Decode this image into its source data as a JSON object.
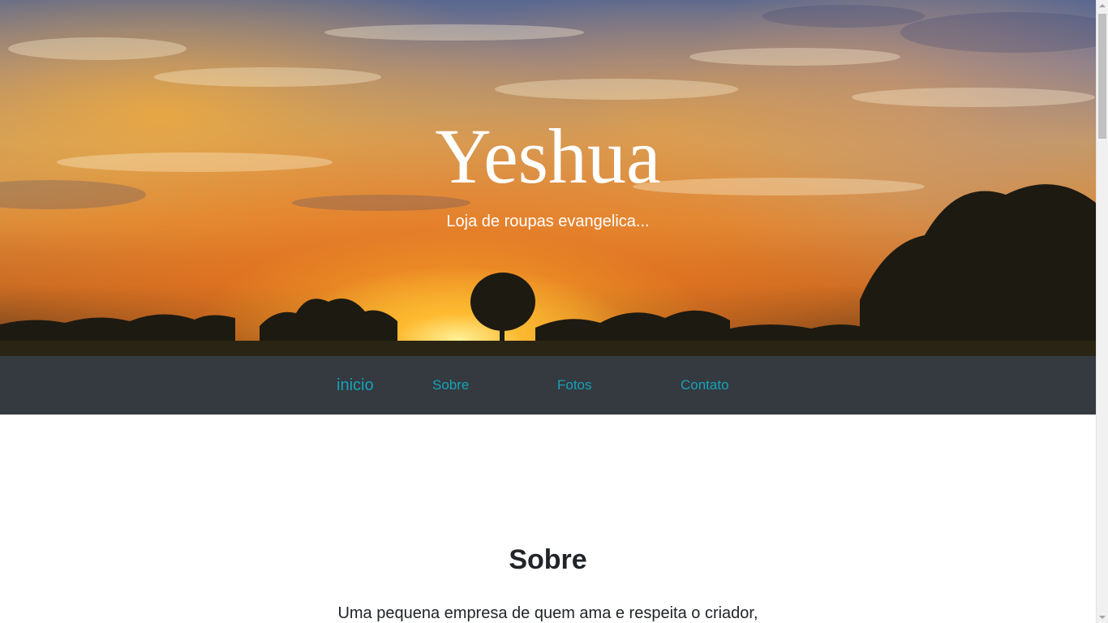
{
  "hero": {
    "title": "Yeshua",
    "subtitle": "Loja de roupas evangelica..."
  },
  "nav": {
    "items": [
      {
        "label": "inicio",
        "active": true
      },
      {
        "label": "Sobre",
        "active": false
      },
      {
        "label": "Fotos",
        "active": false
      },
      {
        "label": "Contato",
        "active": false
      }
    ]
  },
  "sobre": {
    "title": "Sobre",
    "text": "Uma pequena empresa de quem ama e respeita o criador,"
  },
  "colors": {
    "nav_background": "#343a40",
    "nav_link": "#17a2b8",
    "text": "#212529",
    "hero_text": "#ffffff"
  }
}
